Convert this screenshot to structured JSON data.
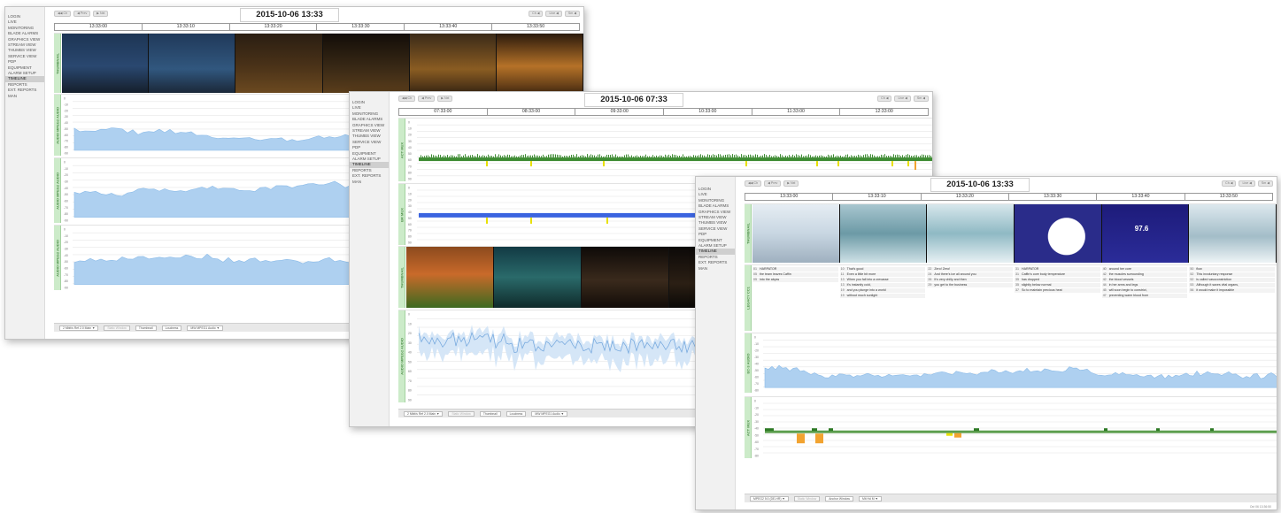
{
  "nav_items": [
    "LOGIN",
    "LIVE",
    "MONITORING",
    "BLADE ALARMS",
    "GRAPHICS VIEW",
    "STREAM VIEW",
    "THUMBS VIEW",
    "SERVICE VIEW",
    "PDP",
    "EQUIPMENT",
    "ALARM SETUP",
    "TIMELINE",
    "REPORTS",
    "EXT. REPORTS",
    "MAN"
  ],
  "active_nav": "TIMELINE",
  "toolbar": {
    "left_buttons": [
      "◀◀ Ch",
      "◀ Prev",
      "▶ Nxt"
    ],
    "right_buttons": [
      "Ch ◀",
      "Live ◀",
      "Sm ◀"
    ]
  },
  "colors": {
    "lane_label_bg": "#ccebc9",
    "audio_fill": "#aed0f0",
    "audio_line": "#8bbbe8",
    "loud_green": "#3d8b32",
    "marker_yellow": "#e8e000",
    "blue_bar": "#3b64e0",
    "orange_bar": "#f2a330"
  },
  "windows": [
    {
      "id": "win1",
      "date": "2015-10-06 13:33",
      "ticks": [
        "13:33:00",
        "13:33:10",
        "13:33:20",
        "13:33:30",
        "13:33:40",
        "13:33:50"
      ],
      "lanes": [
        "THUMBNAIL",
        "AUDIO MPEG2 AUDIO",
        "AUDIO MPEG2 AUDIO",
        "AUDIO MPEG2 AUDIO"
      ],
      "scale_labels": [
        "0",
        "-10",
        "-20",
        "-30",
        "-40",
        "-50",
        "-60",
        "-70",
        "-80",
        "-90"
      ],
      "bottom_controls": [
        "2 Mbit/s Ref 2.0 Main ▼",
        "Static Window",
        "Thumbnail",
        "Loudness",
        "MW MPEG1 Audio ▼"
      ]
    },
    {
      "id": "win2",
      "date": "2015-10-06 07:33",
      "ticks": [
        "07:33:00",
        "08:33:00",
        "09:33:00",
        "10:33:00",
        "11:33:00",
        "12:33:00"
      ],
      "lanes": [
        "ACT MUX",
        "BR MUX",
        "THUMBNAIL",
        "AUDIO MPEG2 AUDIO"
      ],
      "scale_labels": [
        "0",
        "10",
        "20",
        "30",
        "40",
        "50",
        "60",
        "70",
        "80",
        "90"
      ],
      "bottom_controls": [
        "2 Mbit/s Ref 2.0 Main ▼",
        "Static Window",
        "Thumbnail",
        "Loudness",
        "MW MPEG1 Audio ▼"
      ]
    },
    {
      "id": "win3",
      "date": "2015-10-06 13:33",
      "ticks": [
        "13:33:00",
        "13:33:10",
        "13:33:20",
        "13:33:30",
        "13:33:40",
        "13:33:50"
      ],
      "lanes": [
        "THUMBNAIL",
        "LEGACY CC1",
        "EC-3 AUDIO",
        "ACT MUX"
      ],
      "scale_labels": [
        "0",
        "-10",
        "-20",
        "-30",
        "-40",
        "-50",
        "-60",
        "-70",
        "-80"
      ],
      "thumb_overlay_value": "97.6",
      "bottom_controls": [
        "MPEG2 5:0 (DE-HR) ▼",
        "Static Window",
        "Anchor Window",
        "Mit Hd M ▼"
      ],
      "footer": "Oct 06 13:36:50",
      "subtitles": [
        [
          [
            "01",
            "HARPATOR"
          ],
          [
            "05",
            "the team leaves Caffin"
          ],
          [
            "05",
            "into the abyss"
          ]
        ],
        [
          [
            "10",
            "That's good"
          ],
          [
            "11",
            "Even a little bit more"
          ],
          [
            "13",
            "When you fall into a crevasse"
          ],
          [
            "13",
            "it's instantly cold,"
          ],
          [
            "19",
            "and you plunge into a world"
          ],
          [
            "19",
            "without much sunlight"
          ]
        ],
        [
          [
            "22",
            "Zero! Zero!"
          ],
          [
            "24",
            "And there's ice all around you"
          ],
          [
            "26",
            "It's very chilly and then"
          ],
          [
            "29",
            "you get to the business"
          ]
        ],
        [
          [
            "31",
            "HARPATOR"
          ],
          [
            "31",
            "Caffin's core body temperature"
          ],
          [
            "35",
            "has dropped"
          ],
          [
            "35",
            "slightly below normal"
          ],
          [
            "37",
            "So to maintain precious heat"
          ]
        ],
        [
          [
            "40",
            "around her core"
          ],
          [
            "42",
            "the muscles surrounding"
          ],
          [
            "42",
            "the blood vessels"
          ],
          [
            "44",
            "in her arms and legs"
          ],
          [
            "45",
            "will soon begin to constrict,"
          ],
          [
            "47",
            "preventing warm blood from"
          ]
        ],
        [
          [
            "50",
            "flow"
          ],
          [
            "52",
            "This involuntary response"
          ],
          [
            "52",
            "is called vasoconstriction"
          ],
          [
            "53",
            "Although it saves vital organs,"
          ],
          [
            "56",
            "it would make it impossible"
          ]
        ]
      ]
    }
  ]
}
